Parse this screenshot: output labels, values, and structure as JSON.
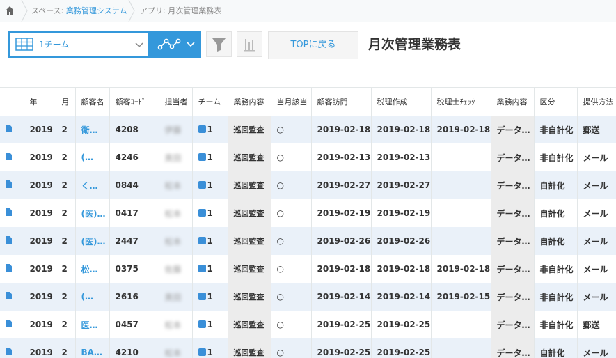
{
  "breadcrumb": {
    "space_prefix": "スペース: ",
    "space_name": "業務管理システム",
    "app": "アプリ: 月次管理業務表"
  },
  "toolbar": {
    "view_name": "1チーム",
    "top_button": "TOPに戻る",
    "title": "月次管理業務表"
  },
  "table": {
    "headers": [
      "年",
      "月",
      "顧客名",
      "顧客ｺｰﾄﾞ",
      "担当者",
      "チーム",
      "業務内容",
      "当月該当",
      "顧客訪問",
      "税理作成",
      "税理士ﾁｪｯｸ",
      "業務内容",
      "区分",
      "提供方法"
    ],
    "rows": [
      {
        "year": "2019",
        "month": "2",
        "customer": "衛…",
        "code": "4208",
        "staff": "伊藤",
        "team": "1",
        "work": "巡回監査",
        "applicable": "○",
        "visit": "2019-02-18",
        "prep": "2019-02-18",
        "check": "2019-02-18",
        "work2": "データ…",
        "kubun": "非自計化",
        "method": "郵送"
      },
      {
        "year": "2019",
        "month": "2",
        "customer": "(…",
        "code": "4246",
        "staff": "奥田",
        "team": "1",
        "work": "巡回監査",
        "applicable": "○",
        "visit": "2019-02-13",
        "prep": "2019-02-13",
        "check": "",
        "work2": "データ…",
        "kubun": "非自計化",
        "method": "メール"
      },
      {
        "year": "2019",
        "month": "2",
        "customer": "く…",
        "code": "0844",
        "staff": "松本",
        "team": "1",
        "work": "巡回監査",
        "applicable": "○",
        "visit": "2019-02-27",
        "prep": "2019-02-27",
        "check": "",
        "work2": "データ…",
        "kubun": "自計化",
        "method": "メール"
      },
      {
        "year": "2019",
        "month": "2",
        "customer": "(医)…",
        "code": "0417",
        "staff": "松本",
        "team": "1",
        "work": "巡回監査",
        "applicable": "○",
        "visit": "2019-02-19",
        "prep": "2019-02-19",
        "check": "",
        "work2": "データ…",
        "kubun": "自計化",
        "method": "メール"
      },
      {
        "year": "2019",
        "month": "2",
        "customer": "(医)…",
        "code": "2447",
        "staff": "松本",
        "team": "1",
        "work": "巡回監査",
        "applicable": "○",
        "visit": "2019-02-26",
        "prep": "2019-02-26",
        "check": "",
        "work2": "データ…",
        "kubun": "自計化",
        "method": "メール"
      },
      {
        "year": "2019",
        "month": "2",
        "customer": "松…",
        "code": "0375",
        "staff": "佐藤",
        "team": "1",
        "work": "巡回監査",
        "applicable": "○",
        "visit": "2019-02-18",
        "prep": "2019-02-18",
        "check": "2019-02-18",
        "work2": "データ…",
        "kubun": "非自計化",
        "method": "メール"
      },
      {
        "year": "2019",
        "month": "2",
        "customer": "(…",
        "code": "2616",
        "staff": "奥田",
        "team": "1",
        "work": "巡回監査",
        "applicable": "○",
        "visit": "2019-02-14",
        "prep": "2019-02-14",
        "check": "2019-02-15",
        "work2": "データ…",
        "kubun": "非自計化",
        "method": "メール"
      },
      {
        "year": "2019",
        "month": "2",
        "customer": "医…",
        "code": "0457",
        "staff": "松本",
        "team": "1",
        "work": "巡回監査",
        "applicable": "○",
        "visit": "2019-02-25",
        "prep": "2019-02-25",
        "check": "",
        "work2": "データ…",
        "kubun": "非自計化",
        "method": "郵送"
      },
      {
        "year": "2019",
        "month": "2",
        "customer": "BA…",
        "code": "4210",
        "staff": "松本",
        "team": "1",
        "work": "巡回監査",
        "applicable": "○",
        "visit": "2019-02-25",
        "prep": "2019-02-25",
        "check": "",
        "work2": "データ…",
        "kubun": "自計化",
        "method": "メール"
      }
    ]
  },
  "colors": {
    "accent": "#3498db",
    "row_alt": "#eaf1f9",
    "header_bg": "#f7f9fa"
  }
}
